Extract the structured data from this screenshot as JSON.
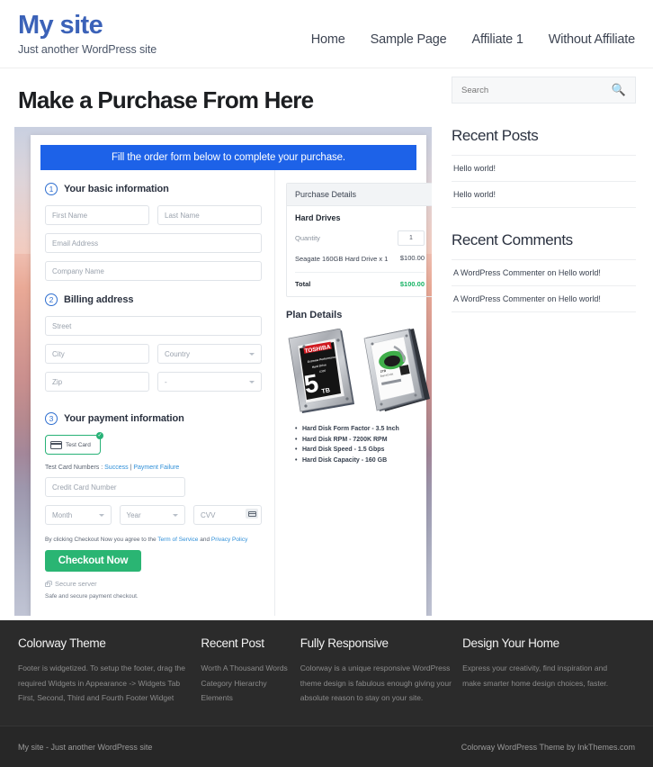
{
  "header": {
    "brand_title": "My site",
    "brand_tagline": "Just another WordPress site",
    "nav": [
      {
        "label": "Home"
      },
      {
        "label": "Sample Page"
      },
      {
        "label": "Affiliate 1"
      },
      {
        "label": "Without Affiliate"
      }
    ]
  },
  "main": {
    "page_title": "Make a Purchase From Here",
    "banner": "Fill the order form below to complete your purchase.",
    "steps": {
      "step1_num": "1",
      "step1_label": "Your basic information",
      "step2_num": "2",
      "step2_label": "Billing address",
      "step3_num": "3",
      "step3_label": "Your payment information"
    },
    "fields": {
      "first_name": "First Name",
      "last_name": "Last Name",
      "email": "Email Address",
      "company": "Company Name",
      "street": "Street",
      "city": "City",
      "country": "Country",
      "zip": "Zip",
      "state": "-",
      "credit_card": "Credit Card Number",
      "month": "Month",
      "year": "Year",
      "cvv": "CVV"
    },
    "payment": {
      "test_card_label": "Test Card",
      "test_nums_prefix": "Test Card Numbers : ",
      "test_nums_success": "Success",
      "test_nums_sep": " | ",
      "test_nums_failure": "Payment Failure",
      "agree_prefix": "By clicking Checkout Now you agree to the ",
      "agree_tos": "Term of Service",
      "agree_and": " and ",
      "agree_privacy": "Privacy Policy",
      "checkout_label": "Checkout Now",
      "secure_server": "Secure server",
      "safe_note": "Safe and secure payment checkout."
    },
    "purchase_details": {
      "head": "Purchase Details",
      "product_title": "Hard Drives",
      "quantity_label": "Quantity",
      "quantity_value": "1",
      "item_name": "Seagate 160GB Hard Drive x 1",
      "item_price": "$100.00",
      "total_label": "Total",
      "total_value": "$100.00"
    },
    "plan": {
      "title": "Plan Details",
      "specs": [
        "Hard Disk Form Factor - 3.5 Inch",
        "Hard Disk RPM - 7200K RPM",
        "Hard Disk Speed - 1.5 Gbps",
        "Hard Disk Capacity - 160 GB"
      ],
      "drive1_brand": "TOSHIBA",
      "drive1_line1": "Extreme Performance",
      "drive1_line2": "Hard Drive",
      "drive1_line3": "X300",
      "drive1_capacity": "5",
      "drive1_unit": "TB",
      "drive2_capacity": "2TB",
      "drive2_line": "BarraCuda"
    }
  },
  "sidebar": {
    "search_placeholder": "Search",
    "search_icon": "search-icon",
    "recent_posts_title": "Recent Posts",
    "recent_posts": [
      {
        "label": "Hello world!"
      },
      {
        "label": "Hello world!"
      }
    ],
    "recent_comments_title": "Recent Comments",
    "recent_comments": [
      {
        "label": "A WordPress Commenter on Hello world!"
      },
      {
        "label": "A WordPress Commenter on Hello world!"
      }
    ]
  },
  "footer": {
    "columns": [
      {
        "title": "Colorway Theme",
        "text": "Footer is widgetized. To setup the footer, drag the required Widgets in Appearance -> Widgets Tab First, Second, Third and Fourth Footer Widget"
      },
      {
        "title": "Recent Post",
        "items": [
          {
            "label": "Worth A Thousand Words"
          },
          {
            "label": "Category Hierarchy"
          },
          {
            "label": "Elements"
          }
        ]
      },
      {
        "title": "Fully Responsive",
        "text": "Colorway is a unique responsive WordPress theme design is fabulous enough giving your absolute reason to stay on your site."
      },
      {
        "title": "Design Your Home",
        "text": "Express your creativity, find inspiration and make smarter home design choices, faster."
      }
    ],
    "bottom_left": "My site - Just another WordPress site",
    "bottom_right": "Colorway WordPress Theme by InkThemes.com"
  },
  "colors": {
    "brand": "#3b62b8",
    "banner_blue": "#1d62e8",
    "checkout_green": "#2ab573",
    "total_green": "#16b364",
    "footer_bg": "#2b2b2b"
  }
}
